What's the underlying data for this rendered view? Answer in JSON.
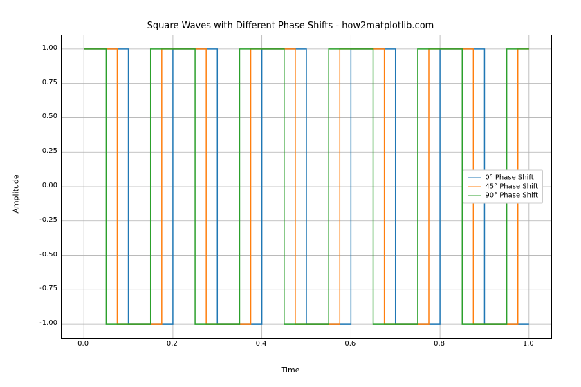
{
  "chart_data": {
    "type": "line",
    "title": "Square Waves with Different Phase Shifts - how2matplotlib.com",
    "xlabel": "Time",
    "ylabel": "Amplitude",
    "xlim": [
      -0.05,
      1.05
    ],
    "ylim": [
      -1.1,
      1.1
    ],
    "xticks": [
      0.0,
      0.2,
      0.4,
      0.6,
      0.8,
      1.0
    ],
    "yticks": [
      -1.0,
      -0.75,
      -0.5,
      -0.25,
      0.0,
      0.25,
      0.5,
      0.75,
      1.0
    ],
    "grid": true,
    "legend_position": "center right",
    "frequency_hz": 5,
    "series": [
      {
        "name": "0° Phase Shift",
        "color": "#1f77b4",
        "phase_deg": 0,
        "transitions_x": [
          0.0,
          0.1,
          0.2,
          0.3,
          0.4,
          0.5,
          0.6,
          0.7,
          0.8,
          0.9,
          1.0
        ],
        "levels": [
          1,
          -1,
          1,
          -1,
          1,
          -1,
          1,
          -1,
          1,
          -1
        ]
      },
      {
        "name": "45° Phase Shift",
        "color": "#ff7f0e",
        "phase_deg": 45,
        "transitions_x": [
          0.0,
          0.075,
          0.175,
          0.275,
          0.375,
          0.475,
          0.575,
          0.675,
          0.775,
          0.875,
          0.975,
          1.0
        ],
        "levels": [
          1,
          -1,
          1,
          -1,
          1,
          -1,
          1,
          -1,
          1,
          -1,
          1
        ]
      },
      {
        "name": "90° Phase Shift",
        "color": "#2ca02c",
        "phase_deg": 90,
        "transitions_x": [
          0.0,
          0.05,
          0.15,
          0.25,
          0.35,
          0.45,
          0.55,
          0.65,
          0.75,
          0.85,
          0.95,
          1.0
        ],
        "levels": [
          1,
          -1,
          1,
          -1,
          1,
          -1,
          1,
          -1,
          1,
          -1,
          1
        ]
      }
    ]
  }
}
